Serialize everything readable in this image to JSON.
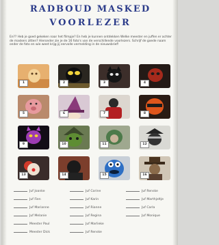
{
  "title_line1": "RADBOUD MASKED",
  "title_line2": "VOORLEZER",
  "intro_text": "En?? Heb je goed gekeken naar het filmpje? En heb je kunnen ontdekken Welke meester en juffen er achter de maskers zitten? Hieronder zie je de 16 foto's van de verschillende voorlezers. Schrijf de goede naam onder de foto en wie weet krijg jij eervolle vermelding in de nieuwsbrief!",
  "photos": [
    {
      "number": "1",
      "icon": "photo-cat-figure"
    },
    {
      "number": "2",
      "icon": "photo-bee-mask"
    },
    {
      "number": "3",
      "icon": "photo-cat-mask"
    },
    {
      "number": "4",
      "icon": "photo-red-mask"
    },
    {
      "number": "5",
      "icon": "photo-pink-pig"
    },
    {
      "number": "6",
      "icon": "photo-wizard-hat"
    },
    {
      "number": "7",
      "icon": "photo-red-cape"
    },
    {
      "number": "8",
      "icon": "photo-orange-hood"
    },
    {
      "number": "9",
      "icon": "photo-devil-mask"
    },
    {
      "number": "10",
      "icon": "photo-green-frog"
    },
    {
      "number": "11",
      "icon": "photo-green-hood"
    },
    {
      "number": "12",
      "icon": "photo-pirate-mask"
    },
    {
      "number": "13",
      "icon": "photo-clown"
    },
    {
      "number": "14",
      "icon": "photo-dark-figure"
    },
    {
      "number": "15",
      "icon": "photo-blue-monster"
    },
    {
      "number": "16",
      "icon": "photo-hat-figure"
    }
  ],
  "names": [
    [
      "Juf Joanke",
      "Juf Corine",
      "Juf Renske"
    ],
    [
      "Juf Fien",
      "Juf Karin",
      "Juf Marthjeltje"
    ],
    [
      "Juf Marianne",
      "Juf Rianne",
      "Juf Carla"
    ],
    [
      "Juf Melanie",
      "Juf Regina",
      "Juf Monique"
    ],
    [
      "Meester Paul",
      "Juf Marlieke",
      ""
    ],
    [
      "Meester Dick",
      "Juf Renske",
      ""
    ]
  ]
}
